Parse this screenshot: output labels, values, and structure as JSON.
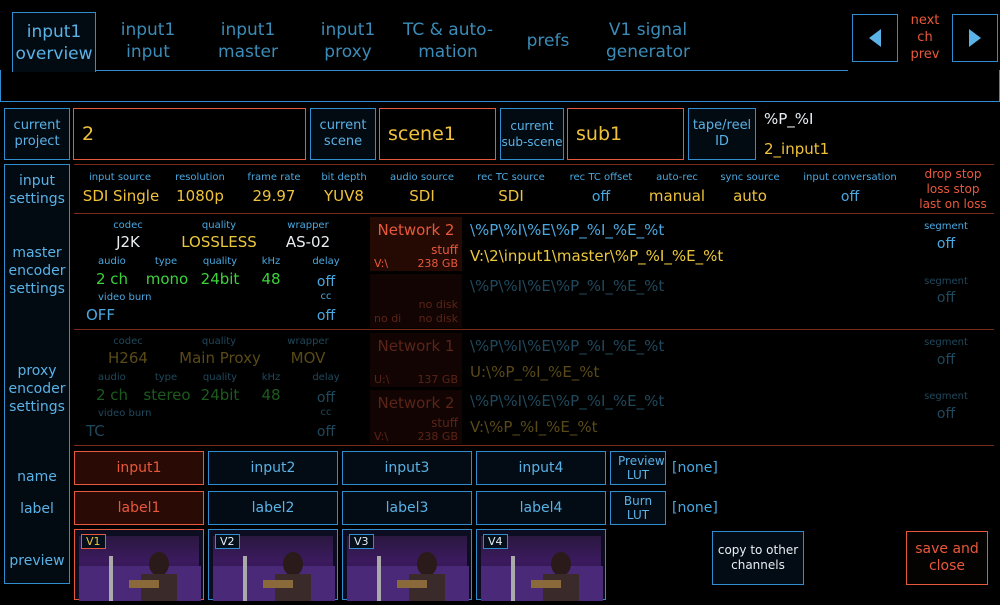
{
  "tabs": [
    {
      "label": "input1 overview",
      "active": true
    },
    {
      "label": "input1 input"
    },
    {
      "label": "input1 master"
    },
    {
      "label": "input1 proxy"
    },
    {
      "label": "TC & auto-mation"
    },
    {
      "label": "prefs"
    },
    {
      "label": "V1 signal generator"
    }
  ],
  "nav": {
    "next": "next",
    "ch": "ch",
    "prev": "prev"
  },
  "project": {
    "label": "current project",
    "value": "2"
  },
  "scene": {
    "label": "current scene",
    "value": "scene1"
  },
  "subscene": {
    "label": "current sub-scene",
    "value": "sub1"
  },
  "tape": {
    "label": "tape/reel ID",
    "pattern": "%P_%I",
    "value": "2_input1"
  },
  "side": {
    "input": "input settings",
    "master": "master encoder settings",
    "proxy": "proxy encoder settings",
    "name": "name",
    "label": "label",
    "preview": "preview"
  },
  "input_settings": {
    "source_label": "input source",
    "source": "SDI Single",
    "resolution_label": "resolution",
    "resolution": "1080p",
    "framerate_label": "frame rate",
    "framerate": "29.97",
    "bitdepth_label": "bit depth",
    "bitdepth": "YUV8",
    "audio_label": "audio source",
    "audio": "SDI",
    "rectc_label": "rec TC source",
    "rectc": "SDI",
    "offset_label": "rec TC offset",
    "offset": "off",
    "autorec_label": "auto-rec",
    "autorec": "manual",
    "sync_label": "sync source",
    "sync": "auto",
    "conv_label": "input conversation",
    "conv": "off",
    "drop1": "drop stop",
    "drop2": "loss stop",
    "drop3": "last on loss"
  },
  "master": {
    "codec_label": "codec",
    "codec": "J2K",
    "quality_label": "quality",
    "quality": "LOSSLESS",
    "wrapper_label": "wrapper",
    "wrapper": "AS-02",
    "audio_label": "audio",
    "audio": "2 ch",
    "type_label": "type",
    "type": "mono",
    "aq_label": "quality",
    "aq": "24bit",
    "khz_label": "kHz",
    "khz": "48",
    "delay_label": "delay",
    "delay": "off",
    "cc_label": "cc",
    "cc": "off",
    "burn_label": "video burn",
    "burn": "OFF",
    "dest1": {
      "name": "Network 2",
      "path": "V:\\",
      "extra": "stuff",
      "size": "238 GB"
    },
    "dest2": {
      "name": "",
      "path": "no di",
      "extra": "no disk",
      "size": "no disk"
    },
    "pattern1": "\\%P\\%I\\%E\\%P_%I_%E_%t",
    "resolved1": "V:\\2\\input1\\master\\%P_%I_%E_%t",
    "pattern2": "\\%P\\%I\\%E\\%P_%I_%E_%t",
    "seg_label": "segment",
    "seg": "off",
    "seg2_label": "segment",
    "seg2": "off"
  },
  "proxy": {
    "codec_label": "codec",
    "codec": "H264",
    "quality_label": "quality",
    "quality": "Main Proxy",
    "wrapper_label": "wrapper",
    "wrapper": "MOV",
    "audio_label": "audio",
    "audio": "2 ch",
    "type_label": "type",
    "type": "stereo",
    "aq_label": "quality",
    "aq": "24bit",
    "khz_label": "kHz",
    "khz": "48",
    "delay_label": "delay",
    "delay": "off",
    "cc_label": "cc",
    "cc": "off",
    "burn_label": "video burn",
    "burn": "TC",
    "dest1": {
      "name": "Network 1",
      "path": "U:\\",
      "size": "137 GB"
    },
    "dest2": {
      "name": "Network 2",
      "path": "V:\\",
      "extra": "stuff",
      "size": "238 GB"
    },
    "pattern1": "\\%P\\%I\\%E\\%P_%I_%E_%t",
    "resolved1": "U:\\%P_%I_%E_%t",
    "pattern2": "\\%P\\%I\\%E\\%P_%I_%E_%t",
    "resolved2": "V:\\%P_%I_%E_%t",
    "seg_label": "segment",
    "seg": "off",
    "seg2_label": "segment",
    "seg2": "off"
  },
  "names": [
    "input1",
    "input2",
    "input3",
    "input4"
  ],
  "labels": [
    "label1",
    "label2",
    "label3",
    "label4"
  ],
  "preview_lut": {
    "label": "Preview LUT",
    "value": "[none]"
  },
  "burn_lut": {
    "label": "Burn LUT",
    "value": "[none]"
  },
  "previews": [
    "V1",
    "V2",
    "V3",
    "V4"
  ],
  "copy_button": "copy to other channels",
  "save_button": "save and close"
}
